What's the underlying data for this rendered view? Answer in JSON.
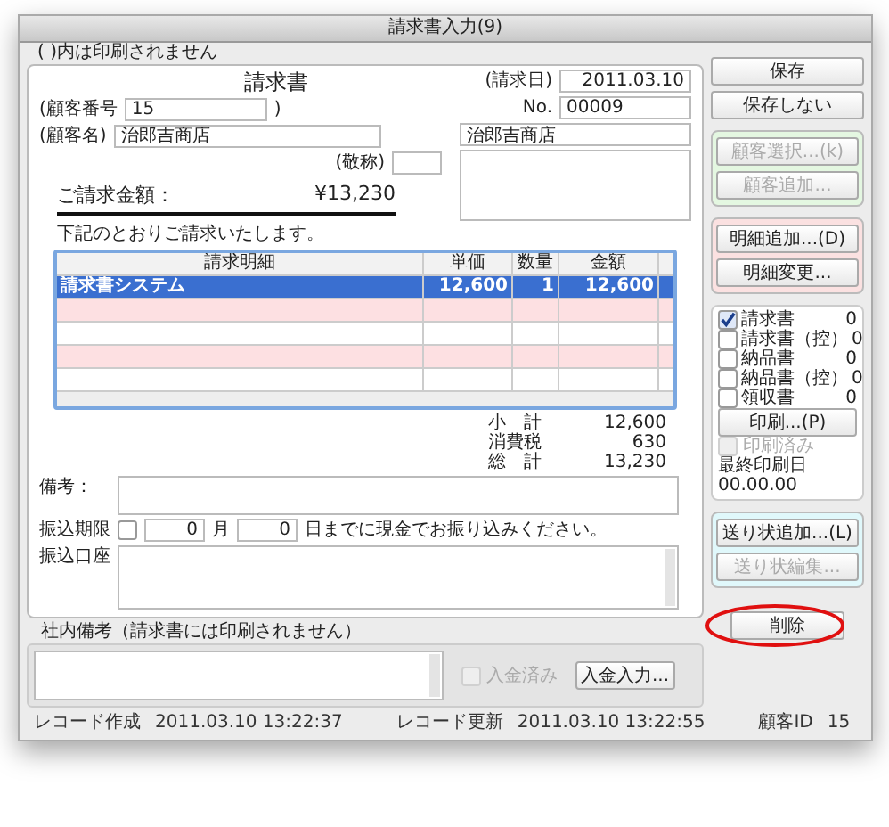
{
  "window": {
    "title": "請求書入力(9)"
  },
  "note": "( )内は印刷されません",
  "invoice": {
    "heading": "請求書",
    "customer_no": {
      "label": "(顧客番号",
      "value": "15",
      "close": ")"
    },
    "customer_name": {
      "label": "(顧客名)",
      "value": "治郎吉商店"
    },
    "honorific": {
      "label": "(敬称)"
    },
    "amount": {
      "label": "ご請求金額：",
      "value": "¥13,230"
    },
    "date": {
      "label": "(請求日)",
      "value": "2011.03.10"
    },
    "number": {
      "label": "No.",
      "value": "00009"
    },
    "address_name": "治郎吉商店",
    "intro": "下記のとおりご請求いたします。"
  },
  "table": {
    "columns": [
      "請求明細",
      "単価",
      "数量",
      "金額"
    ],
    "rows": [
      {
        "cells": [
          "請求書システム",
          "12,600",
          "1",
          "12,600"
        ],
        "selected": true
      },
      {
        "cells": [
          "",
          "",
          "",
          ""
        ],
        "selected": false
      },
      {
        "cells": [
          "",
          "",
          "",
          ""
        ],
        "selected": false
      },
      {
        "cells": [
          "",
          "",
          "",
          ""
        ],
        "selected": false
      },
      {
        "cells": [
          "",
          "",
          "",
          ""
        ],
        "selected": false
      }
    ]
  },
  "totals": [
    {
      "label": "小　計",
      "value": "12,600"
    },
    {
      "label": "消費税",
      "value": "630"
    },
    {
      "label": "総　計",
      "value": "13,230"
    }
  ],
  "remarks": {
    "label": "備考："
  },
  "deadline": {
    "label": "振込期限",
    "checked": false,
    "month": "0",
    "month_unit": "月",
    "day": "0",
    "text": "日までに現金でお振り込みください。"
  },
  "account": {
    "label": "振込口座"
  },
  "internal": {
    "label": "社内備考（請求書には印刷されません）",
    "paid": {
      "label": "入金済み",
      "checked": false,
      "disabled": true
    },
    "button": "入金入力..."
  },
  "footer": [
    {
      "label": "レコード作成",
      "value": "2011.03.10 13:22:37"
    },
    {
      "label": "レコード更新",
      "value": "2011.03.10 13:22:55"
    },
    {
      "label": "顧客ID",
      "value": "15"
    }
  ],
  "side": {
    "top_buttons": [
      {
        "label": "保存",
        "disabled": false
      },
      {
        "label": "保存しない",
        "disabled": false
      }
    ],
    "groups": [
      {
        "color": "#e4f7e1",
        "buttons": [
          {
            "label": "顧客選択...(k)",
            "disabled": true
          },
          {
            "label": "顧客追加...",
            "disabled": true
          }
        ]
      },
      {
        "color": "#fbe1e1",
        "buttons": [
          {
            "label": "明細追加...(D)",
            "disabled": false
          },
          {
            "label": "明細変更...",
            "disabled": false
          }
        ]
      }
    ],
    "print": {
      "docs": [
        {
          "label": "請求書",
          "checked": true,
          "count": "0"
        },
        {
          "label": "請求書（控）",
          "checked": false,
          "count": "0"
        },
        {
          "label": "納品書",
          "checked": false,
          "count": "0"
        },
        {
          "label": "納品書（控）",
          "checked": false,
          "count": "0"
        },
        {
          "label": "領収書",
          "checked": false,
          "count": "0"
        }
      ],
      "button": "印刷...(P)",
      "printed": {
        "label": "印刷済み",
        "checked": false,
        "disabled": true
      },
      "last_label": "最終印刷日",
      "last_value": "00.00.00"
    },
    "ship": {
      "color": "#e0f8fb",
      "buttons": [
        {
          "label": "送り状追加...(L)",
          "disabled": false
        },
        {
          "label": "送り状編集...",
          "disabled": true
        }
      ]
    },
    "delete": {
      "label": "削除",
      "highlighted": true
    }
  }
}
